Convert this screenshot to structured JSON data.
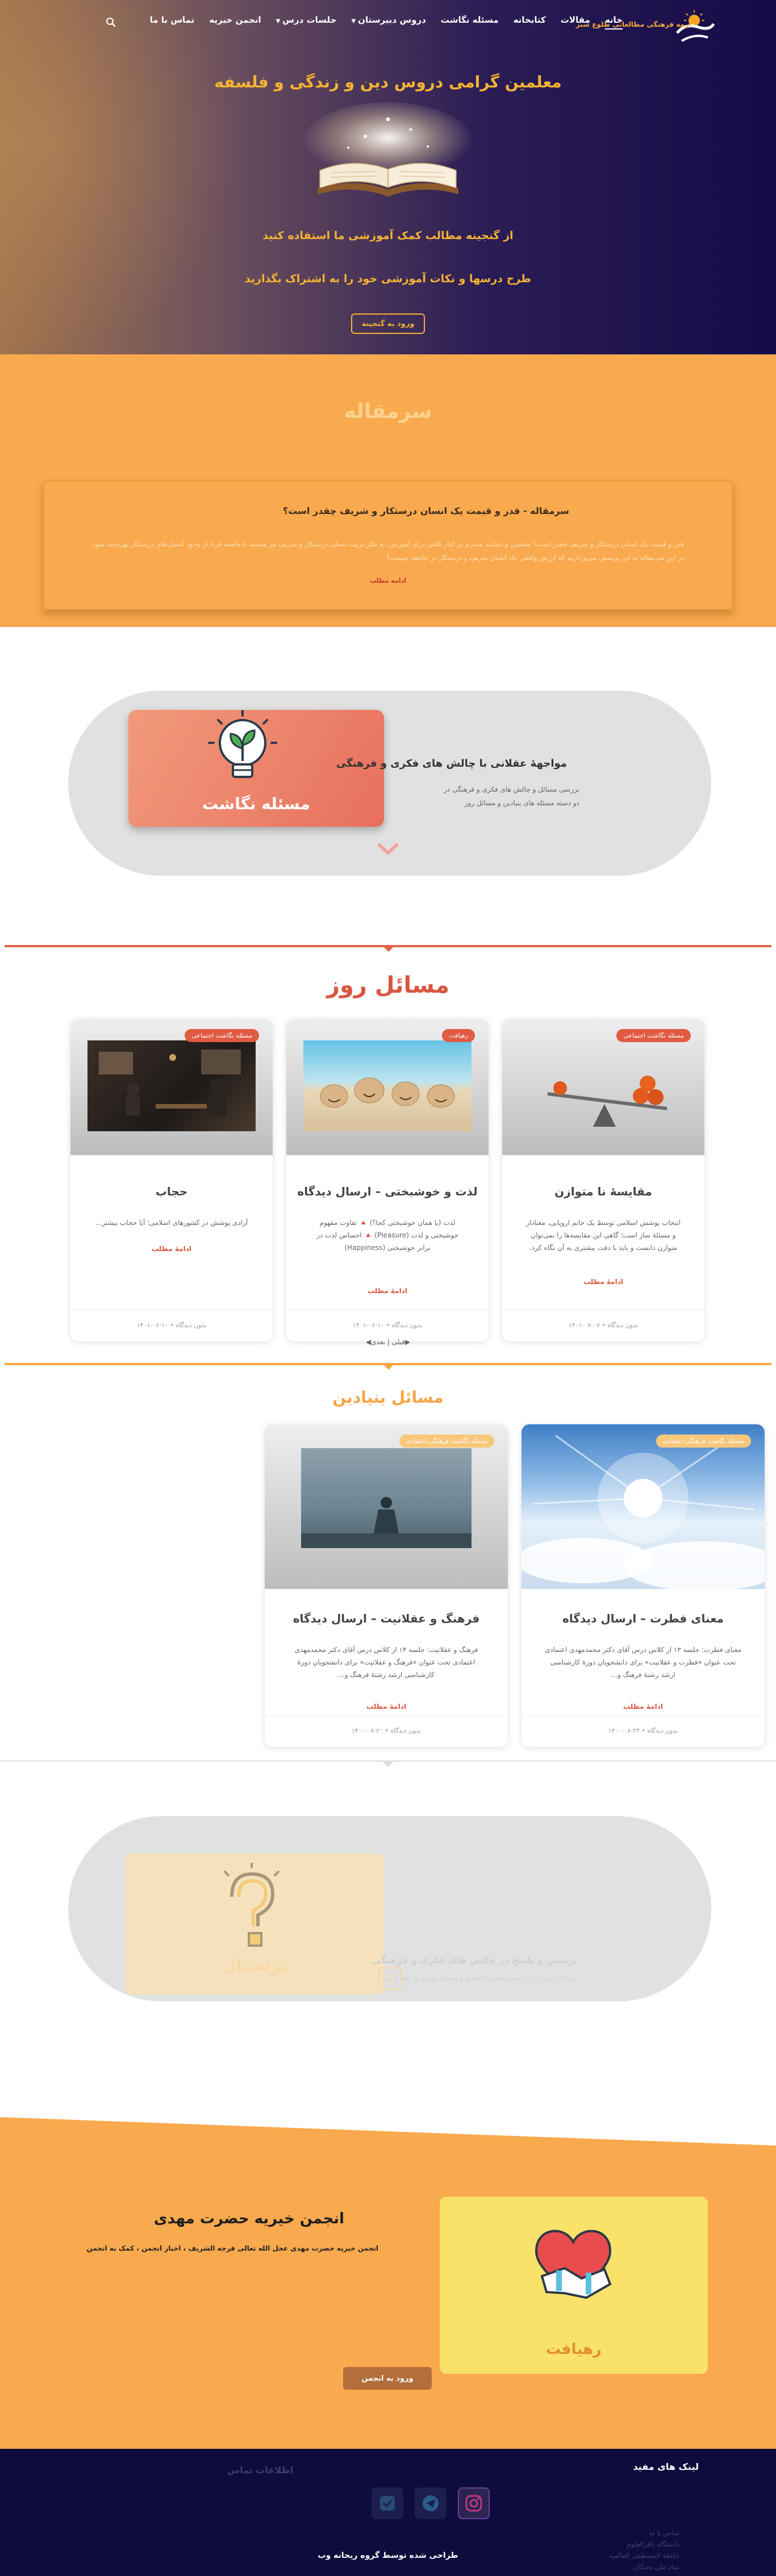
{
  "nav": {
    "logo_text": "طلوع",
    "tagline": "آرمه فرهنگی مطالعاتی طلوع سبز",
    "items": [
      {
        "label": "خانه"
      },
      {
        "label": "مقالات"
      },
      {
        "label": "کتابخانه"
      },
      {
        "label": "مسئله نگاشت"
      },
      {
        "label": "دروس دبیرستان"
      },
      {
        "label": "جلسات درس"
      },
      {
        "label": "انجمن خیریه"
      },
      {
        "label": "تماس با ما"
      }
    ],
    "search_icon": "search-icon"
  },
  "hero": {
    "title": "معلمین گرامی دروس دین و زندگی و فلسفه",
    "line1": "از گنجینه مطالب کمک آموزشی ما استفاده کنید",
    "line2": "طرح درسها و نکات آموزشی خود را به اشتراک بگذارید",
    "button": "ورود به گنجینه"
  },
  "editorial": {
    "heading": "سرمقاله",
    "title": "سرمقاله - قدر و قیمت یک انسان درستکار و شریف چقدر است؟",
    "text": "قدر و قیمت یک انسان درستکار و شریف چقدر است؟ معلمین و اساتید محترم در کنار تلاش برای آموزش، به فکر تربیت نسلی درستکار و شریف نیز هستند تا جامعه فردا از وجود انسان‌های درستکار بهره‌مند شود. در این سرمقاله به این پرسش می‌پردازیم که ارزش واقعی یک انسان شریف و درستکار در جامعه چیست؟",
    "more": "ادامه مطلب"
  },
  "slider": {
    "card_label": "مسئله نگاشت",
    "title": "مواجهۀ عقلانی با چالش های فکری و فرهنگی",
    "desc": "بررسی مسائل و چالش های فکری و فرهنگی در دو دسته مسئله های بنیادین و مسائل روز"
  },
  "current_issues": {
    "heading": "مسائل روز",
    "pager": "◀قبلی | بعدی▶",
    "cards": [
      {
        "badge": "مسئله نگاشت اجتماعی",
        "title": "مقایسهٔ نا متوازن",
        "text": "انتخاب پوشش اسلامی توسط یک خانم اروپایی، معنادار و مسئلهٔ ساز است؛ گاهی این مقایسه‌ها را نمی‌توان متوازن دانست و باید با دقت بیشتری به آن نگاه کرد.",
        "more": "ادامهٔ مطلب",
        "meta": "۱۴۰۱-۰۷-۰۷ • بدون دیدگاه"
      },
      {
        "badge": "رهیافت",
        "title": "لذت و خوشبختی – ارسال دیدگاه",
        "text": "لذت (یا همان خوشبختی کجا؟) 🔺 تفاوت مفهوم خوشبختی و لذت (Pleasure) 🔺 احساس لذت در برابر خوشبختی (Happiness)",
        "more": "ادامهٔ مطلب",
        "meta": "۱۴۰۱-۰۶-۱۰ • بدون دیدگاه"
      },
      {
        "badge": "مسئله نگاشت اجتماعی",
        "title": "حجاب",
        "text": "آزادی پوشش در کشورهای اسلامی؛ آیا حجاب بیشتر...",
        "more": "ادامهٔ مطلب",
        "meta": "۱۴۰۱-۰۶-۱۰ • بدون دیدگاه"
      }
    ]
  },
  "fundamental": {
    "heading": "مسائل بنیادین",
    "cards": [
      {
        "badge": "مسئله نگاشت فرهنگی-اعتقادی",
        "title": "معنای فطرت – ارسال دیدگاه",
        "text": "معنای فطرت: جلسه ۱۳ از کلاس درس آقای دکتر محمدمهدی اعتمادی تحت عنوان «فطرت و عقلانیت» برای دانشجویان دورهٔ کارشناسی ارشد رشتهٔ فرهنگ و...",
        "more": "ادامهٔ مطلب",
        "meta": "۱۴۰۰-۰۸-۲۳ • بدون دیدگاه"
      },
      {
        "badge": "مسئله نگاشت فرهنگی-اعتقادی",
        "title": "فرهنگ و عقلانیت – ارسال دیدگاه",
        "text": "فرهنگ و عقلانیت: جلسه ۱۴ از کلاس درس آقای دکتر محمدمهدی اعتمادی تحت عنوان «فرهنگ و عقلانیت» برای دانشجویان دورهٔ کارشناسی ارشد رشتهٔ فرهنگ و...",
        "more": "ادامهٔ مطلب",
        "meta": "۱۴۰۰-۰۸-۲۰ • بدون دیدگاه"
      }
    ]
  },
  "qa": {
    "card_label": "پرسمان",
    "title": "پرسش و پاسخ در چالش های فکری و فرهنگی",
    "desc": "سوالات خود را در زمینه مسائل اعتقادی و مسئلهٔ روز با ما مطرح کنید"
  },
  "partner": {
    "card_label": "رهیافت",
    "title": "انجمن خیریه حضرت مهدی",
    "desc": "انجمن خیریه حضرت مهدی عجل الله تعالی فرجه الشریف ، اخبار انجمن ، کمک به انجمن",
    "button": "ورود به انجمن"
  },
  "footer": {
    "links_title": "لینک های مفید",
    "contact_title": "اطلاعات تماس",
    "links": [
      "تماس با ما",
      "دانشگاه باقرالعلوم",
      "جامعهٔ المصطفی العالمیه",
      "بنیاد ملی نخبگان"
    ],
    "credit": "طراحی شده توسط گروه ریحانه وب",
    "social": [
      "instagram-icon",
      "telegram-icon",
      "link-icon"
    ]
  },
  "colors": {
    "accent_orange": "#f9a94e",
    "accent_red": "#d9573f",
    "hero_gold": "#f6b332",
    "footer_navy": "#0e0c3c"
  }
}
